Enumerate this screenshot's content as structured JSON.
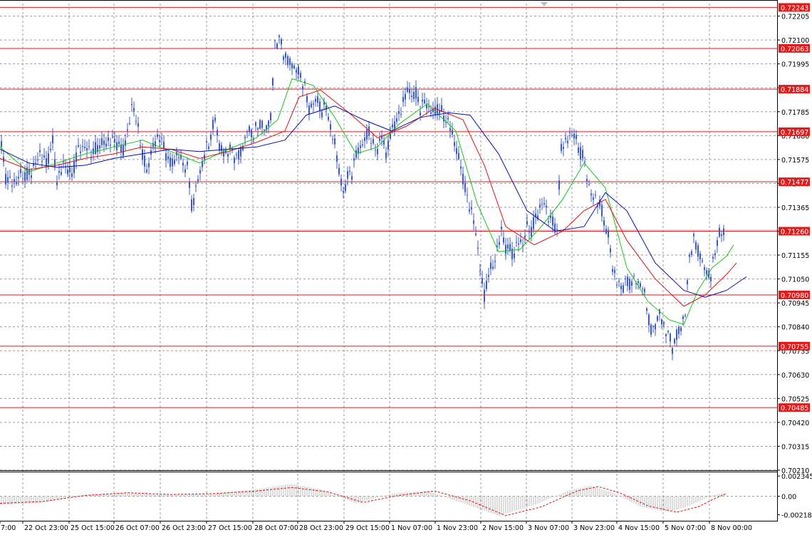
{
  "colors": {
    "background": "#ffffff",
    "grid": "#9a9a9a",
    "candles": "#3a5bc7",
    "level_line": "#e31a1a",
    "level_label_bg": "#e31a1a",
    "level_label_text": "#ffffff",
    "ma_fast": "#16c816",
    "ma_mid": "#dd1111",
    "ma_slow": "#0b0bb0",
    "osc_histogram": "#b8b8b8",
    "osc_signal": "#dd1111",
    "axis_text": "#000000"
  },
  "chart_data": [
    {
      "type": "candlestick",
      "symbol_icon": "chart-shift-marker-icon",
      "price_axis_ticks": [
        "0.72205",
        "0.72100",
        "0.71995",
        "0.71890",
        "0.71785",
        "0.71680",
        "0.71575",
        "0.71470",
        "0.71365",
        "0.71260",
        "0.71155",
        "0.71050",
        "0.70945",
        "0.70840",
        "0.70735",
        "0.70630",
        "0.70525",
        "0.70420",
        "0.70315",
        "0.70210"
      ],
      "time_axis_ticks": [
        "7:00",
        "22 Oct 23:00",
        "25 Oct 15:00",
        "26 Oct 07:00",
        "26 Oct 23:00",
        "27 Oct 15:00",
        "28 Oct 07:00",
        "28 Oct 23:00",
        "29 Oct 15:00",
        "1 Nov 07:00",
        "1 Nov 23:00",
        "2 Nov 15:00",
        "3 Nov 07:00",
        "3 Nov 23:00",
        "4 Nov 15:00",
        "5 Nov 07:00",
        "8 Nov 00:00"
      ],
      "ylim": [
        0.7021,
        0.7226
      ],
      "levels": [
        "0.72243",
        "0.72063",
        "0.71884",
        "0.71697",
        "0.71477",
        "0.71260",
        "0.70980",
        "0.70755",
        "0.70485"
      ],
      "current_price": 0.71265,
      "price_path": [
        [
          0,
          0.7168
        ],
        [
          8,
          0.715
        ],
        [
          14,
          0.7148
        ],
        [
          22,
          0.7147
        ],
        [
          28,
          0.7151
        ],
        [
          36,
          0.715
        ],
        [
          44,
          0.7152
        ],
        [
          56,
          0.716
        ],
        [
          65,
          0.7156
        ],
        [
          74,
          0.7165
        ],
        [
          80,
          0.7148
        ],
        [
          90,
          0.7156
        ],
        [
          100,
          0.715
        ],
        [
          110,
          0.7162
        ],
        [
          120,
          0.7163
        ],
        [
          130,
          0.716
        ],
        [
          140,
          0.7164
        ],
        [
          150,
          0.7165
        ],
        [
          162,
          0.7166
        ],
        [
          172,
          0.7161
        ],
        [
          180,
          0.717
        ],
        [
          186,
          0.7183
        ],
        [
          193,
          0.7172
        ],
        [
          200,
          0.716
        ],
        [
          206,
          0.7152
        ],
        [
          214,
          0.7163
        ],
        [
          224,
          0.7168
        ],
        [
          232,
          0.7161
        ],
        [
          240,
          0.7155
        ],
        [
          250,
          0.716
        ],
        [
          258,
          0.7155
        ],
        [
          264,
          0.7153
        ],
        [
          270,
          0.7135
        ],
        [
          276,
          0.7147
        ],
        [
          282,
          0.7153
        ],
        [
          290,
          0.7163
        ],
        [
          296,
          0.7167
        ],
        [
          302,
          0.7176
        ],
        [
          308,
          0.7163
        ],
        [
          316,
          0.716
        ],
        [
          324,
          0.7162
        ],
        [
          332,
          0.7158
        ],
        [
          340,
          0.7162
        ],
        [
          348,
          0.7171
        ],
        [
          356,
          0.7168
        ],
        [
          364,
          0.7174
        ],
        [
          372,
          0.717
        ],
        [
          380,
          0.7176
        ],
        [
          386,
          0.7208
        ],
        [
          392,
          0.7211
        ],
        [
          398,
          0.7204
        ],
        [
          404,
          0.7201
        ],
        [
          410,
          0.7199
        ],
        [
          416,
          0.7197
        ],
        [
          422,
          0.7194
        ],
        [
          428,
          0.7189
        ],
        [
          434,
          0.718
        ],
        [
          440,
          0.7182
        ],
        [
          446,
          0.7184
        ],
        [
          452,
          0.7178
        ],
        [
          458,
          0.7182
        ],
        [
          464,
          0.717
        ],
        [
          470,
          0.7165
        ],
        [
          476,
          0.7152
        ],
        [
          482,
          0.7143
        ],
        [
          488,
          0.715
        ],
        [
          494,
          0.7152
        ],
        [
          500,
          0.716
        ],
        [
          506,
          0.7163
        ],
        [
          512,
          0.7166
        ],
        [
          518,
          0.717
        ],
        [
          524,
          0.7163
        ],
        [
          530,
          0.7162
        ],
        [
          536,
          0.7168
        ],
        [
          542,
          0.716
        ],
        [
          548,
          0.7168
        ],
        [
          554,
          0.7174
        ],
        [
          560,
          0.7176
        ],
        [
          566,
          0.7183
        ],
        [
          572,
          0.7188
        ],
        [
          578,
          0.7186
        ],
        [
          584,
          0.7186
        ],
        [
          590,
          0.718
        ],
        [
          596,
          0.7183
        ],
        [
          602,
          0.718
        ],
        [
          608,
          0.7178
        ],
        [
          614,
          0.718
        ],
        [
          620,
          0.7178
        ],
        [
          626,
          0.7175
        ],
        [
          632,
          0.7172
        ],
        [
          638,
          0.7165
        ],
        [
          644,
          0.7158
        ],
        [
          650,
          0.715
        ],
        [
          656,
          0.714
        ],
        [
          662,
          0.7135
        ],
        [
          668,
          0.7125
        ],
        [
          674,
          0.711
        ],
        [
          680,
          0.7097
        ],
        [
          686,
          0.7108
        ],
        [
          692,
          0.711
        ],
        [
          698,
          0.7118
        ],
        [
          704,
          0.7126
        ],
        [
          710,
          0.7119
        ],
        [
          716,
          0.7118
        ],
        [
          722,
          0.7116
        ],
        [
          728,
          0.7122
        ],
        [
          734,
          0.712
        ],
        [
          740,
          0.7128
        ],
        [
          746,
          0.7126
        ],
        [
          752,
          0.7132
        ],
        [
          758,
          0.7136
        ],
        [
          764,
          0.7139
        ],
        [
          770,
          0.7132
        ],
        [
          776,
          0.713
        ],
        [
          782,
          0.7127
        ],
        [
          788,
          0.7163
        ],
        [
          794,
          0.7165
        ],
        [
          800,
          0.7168
        ],
        [
          806,
          0.7169
        ],
        [
          812,
          0.7162
        ],
        [
          818,
          0.716
        ],
        [
          824,
          0.715
        ],
        [
          830,
          0.7142
        ],
        [
          836,
          0.714
        ],
        [
          842,
          0.7138
        ],
        [
          848,
          0.713
        ],
        [
          854,
          0.7124
        ],
        [
          860,
          0.711
        ],
        [
          866,
          0.7104
        ],
        [
          872,
          0.7101
        ],
        [
          878,
          0.7104
        ],
        [
          884,
          0.7103
        ],
        [
          890,
          0.7105
        ],
        [
          896,
          0.7103
        ],
        [
          902,
          0.7102
        ],
        [
          908,
          0.7093
        ],
        [
          914,
          0.7082
        ],
        [
          920,
          0.7085
        ],
        [
          926,
          0.709
        ],
        [
          932,
          0.7084
        ],
        [
          938,
          0.7081
        ],
        [
          944,
          0.7075
        ],
        [
          950,
          0.708
        ],
        [
          956,
          0.7084
        ],
        [
          962,
          0.709
        ],
        [
          968,
          0.7115
        ],
        [
          974,
          0.7122
        ],
        [
          980,
          0.7118
        ],
        [
          986,
          0.7112
        ],
        [
          992,
          0.7108
        ],
        [
          998,
          0.7106
        ],
        [
          1004,
          0.7118
        ],
        [
          1010,
          0.7124
        ],
        [
          1016,
          0.7126
        ]
      ],
      "series": [
        {
          "style": "line",
          "color_key": "ma_fast",
          "points": [
            [
              0,
              0.7163
            ],
            [
              40,
              0.7152
            ],
            [
              80,
              0.7156
            ],
            [
              120,
              0.716
            ],
            [
              160,
              0.7163
            ],
            [
              200,
              0.7166
            ],
            [
              240,
              0.7161
            ],
            [
              280,
              0.7156
            ],
            [
              320,
              0.7162
            ],
            [
              360,
              0.7167
            ],
            [
              390,
              0.7175
            ],
            [
              410,
              0.7193
            ],
            [
              440,
              0.719
            ],
            [
              470,
              0.7176
            ],
            [
              500,
              0.716
            ],
            [
              530,
              0.7163
            ],
            [
              560,
              0.7173
            ],
            [
              600,
              0.7182
            ],
            [
              640,
              0.717
            ],
            [
              670,
              0.7138
            ],
            [
              700,
              0.7117
            ],
            [
              730,
              0.7118
            ],
            [
              760,
              0.7128
            ],
            [
              790,
              0.714
            ],
            [
              820,
              0.7156
            ],
            [
              850,
              0.7145
            ],
            [
              880,
              0.711
            ],
            [
              910,
              0.7095
            ],
            [
              940,
              0.7087
            ],
            [
              960,
              0.7085
            ],
            [
              980,
              0.71
            ],
            [
              1000,
              0.711
            ],
            [
              1020,
              0.7115
            ],
            [
              1030,
              0.712
            ]
          ]
        },
        {
          "style": "line",
          "color_key": "ma_mid",
          "points": [
            [
              0,
              0.7158
            ],
            [
              40,
              0.7153
            ],
            [
              80,
              0.7155
            ],
            [
              120,
              0.7158
            ],
            [
              160,
              0.716
            ],
            [
              200,
              0.7163
            ],
            [
              240,
              0.7162
            ],
            [
              280,
              0.7158
            ],
            [
              320,
              0.7161
            ],
            [
              360,
              0.7165
            ],
            [
              400,
              0.717
            ],
            [
              420,
              0.7185
            ],
            [
              450,
              0.7188
            ],
            [
              490,
              0.7178
            ],
            [
              530,
              0.7167
            ],
            [
              570,
              0.7172
            ],
            [
              610,
              0.718
            ],
            [
              650,
              0.7175
            ],
            [
              680,
              0.7155
            ],
            [
              710,
              0.7128
            ],
            [
              750,
              0.712
            ],
            [
              790,
              0.7126
            ],
            [
              820,
              0.7135
            ],
            [
              850,
              0.714
            ],
            [
              880,
              0.7122
            ],
            [
              920,
              0.7105
            ],
            [
              960,
              0.7093
            ],
            [
              990,
              0.7098
            ],
            [
              1020,
              0.7107
            ],
            [
              1034,
              0.7112
            ]
          ]
        },
        {
          "style": "line",
          "color_key": "ma_slow",
          "points": [
            [
              0,
              0.7162
            ],
            [
              40,
              0.7156
            ],
            [
              80,
              0.7154
            ],
            [
              120,
              0.7155
            ],
            [
              160,
              0.7158
            ],
            [
              200,
              0.716
            ],
            [
              240,
              0.7162
            ],
            [
              280,
              0.7161
            ],
            [
              320,
              0.7162
            ],
            [
              360,
              0.7163
            ],
            [
              400,
              0.7166
            ],
            [
              430,
              0.7177
            ],
            [
              470,
              0.7181
            ],
            [
              510,
              0.7175
            ],
            [
              550,
              0.717
            ],
            [
              590,
              0.7176
            ],
            [
              630,
              0.7178
            ],
            [
              660,
              0.7177
            ],
            [
              700,
              0.716
            ],
            [
              740,
              0.7135
            ],
            [
              780,
              0.7126
            ],
            [
              820,
              0.7128
            ],
            [
              850,
              0.7143
            ],
            [
              880,
              0.7135
            ],
            [
              920,
              0.7112
            ],
            [
              960,
              0.71
            ],
            [
              990,
              0.7097
            ],
            [
              1020,
              0.71
            ],
            [
              1048,
              0.7106
            ]
          ]
        }
      ],
      "oscillator": {
        "type": "histogram",
        "ticks": [
          "0.002345",
          "0.00",
          "-0.002184"
        ],
        "ylim": [
          -0.0027,
          0.0028
        ],
        "histogram": [
          [
            0,
            -0.001
          ],
          [
            60,
            -0.0007
          ],
          [
            120,
            0.0002
          ],
          [
            180,
            0.0004
          ],
          [
            240,
            0.0002
          ],
          [
            300,
            0.0003
          ],
          [
            360,
            0.0008
          ],
          [
            410,
            0.0014
          ],
          [
            450,
            0.0008
          ],
          [
            500,
            -0.0008
          ],
          [
            550,
            0.0003
          ],
          [
            600,
            0.0006
          ],
          [
            650,
            -0.0008
          ],
          [
            700,
            -0.0022
          ],
          [
            750,
            -0.001
          ],
          [
            800,
            0.0007
          ],
          [
            830,
            0.0012
          ],
          [
            860,
            0.0004
          ],
          [
            900,
            -0.0012
          ],
          [
            940,
            -0.0018
          ],
          [
            970,
            -0.001
          ],
          [
            1000,
            0.0001
          ],
          [
            1018,
            0.0004
          ]
        ],
        "signal": [
          [
            0,
            -0.0008
          ],
          [
            60,
            -0.0006
          ],
          [
            120,
            0.0001
          ],
          [
            180,
            0.0004
          ],
          [
            240,
            0.0002
          ],
          [
            300,
            0.0003
          ],
          [
            360,
            0.0006
          ],
          [
            410,
            0.001
          ],
          [
            460,
            0.0005
          ],
          [
            510,
            -0.0007
          ],
          [
            560,
            0.0001
          ],
          [
            610,
            0.0006
          ],
          [
            660,
            -0.0005
          ],
          [
            710,
            -0.0022
          ],
          [
            760,
            -0.0012
          ],
          [
            810,
            0.0006
          ],
          [
            840,
            0.0011
          ],
          [
            870,
            0.0004
          ],
          [
            910,
            -0.0011
          ],
          [
            950,
            -0.0018
          ],
          [
            980,
            -0.0012
          ],
          [
            1005,
            -0.0002
          ],
          [
            1020,
            0.0003
          ]
        ]
      }
    }
  ]
}
